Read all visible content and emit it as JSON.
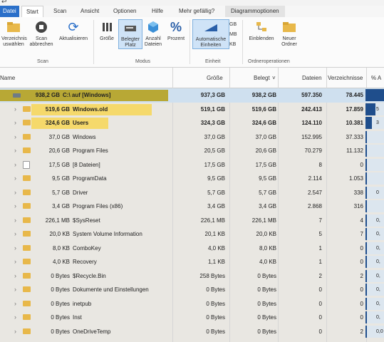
{
  "title_arrow": "↩",
  "tabs": {
    "file": "Datei",
    "start": "Start",
    "scan": "Scan",
    "view": "Ansicht",
    "options": "Optionen",
    "help": "Hilfe",
    "like": "Mehr gefällig?",
    "chart": "Diagrammoptionen"
  },
  "ribbon": {
    "select_dir": "Verzeichnis",
    "select_dir2": "uswählen",
    "scan_btn": "Scan",
    "scan_btn2": "abbrechen",
    "refresh": "Aktualisieren",
    "size": "Größe",
    "allocated": "Belegter",
    "allocated2": "Platz",
    "count": "Anzahl",
    "count2": "Dateien",
    "percent": "Prozent",
    "auto_units": "Automatische",
    "auto_units2": "Einheiten",
    "gb": "GB",
    "mb": "MB",
    "kb": "KB",
    "fold_in": "Einblenden",
    "new_folder": "Neuer",
    "new_folder2": "Ordner",
    "group_scan": "Scan",
    "group_mode": "Modus",
    "group_unit": "Einheit",
    "group_folder": "Ordneroperationen"
  },
  "columns": {
    "name": "Name",
    "size": "Größe",
    "allocated": "Belegt",
    "files": "Dateien",
    "folders": "Verzeichnisse",
    "percent": "% A"
  },
  "rows": [
    {
      "alloc_label": "938,2 GB",
      "name": "C:\\ auf [Windows]",
      "size": "937,3 GB",
      "allocated": "938,2 GB",
      "files": "597.350",
      "folders": "78.445",
      "pct": 100
    },
    {
      "alloc_label": "519,6 GB",
      "name": "Windows.old",
      "size": "519,1 GB",
      "allocated": "519,6 GB",
      "files": "242.413",
      "folders": "17.859",
      "pct": 55
    },
    {
      "alloc_label": "324,6 GB",
      "name": "Users",
      "size": "324,3 GB",
      "allocated": "324,6 GB",
      "files": "124.110",
      "folders": "10.381",
      "pct": 35
    },
    {
      "alloc_label": "37,0 GB",
      "name": "Windows",
      "size": "37,0 GB",
      "allocated": "37,0 GB",
      "files": "152.995",
      "folders": "37.333",
      "pct": 4
    },
    {
      "alloc_label": "20,6 GB",
      "name": "Program Files",
      "size": "20,5 GB",
      "allocated": "20,6 GB",
      "files": "70.279",
      "folders": "11.132",
      "pct": 2
    },
    {
      "alloc_label": "17,5 GB",
      "name": "[8 Dateien]",
      "size": "17,5 GB",
      "allocated": "17,5 GB",
      "files": "8",
      "folders": "0",
      "pct": 2
    },
    {
      "alloc_label": "9,5 GB",
      "name": "ProgramData",
      "size": "9,5 GB",
      "allocated": "9,5 GB",
      "files": "2.114",
      "folders": "1.053",
      "pct": 1
    },
    {
      "alloc_label": "5,7 GB",
      "name": "Driver",
      "size": "5,7 GB",
      "allocated": "5,7 GB",
      "files": "2.547",
      "folders": "338",
      "pct": 0.6
    },
    {
      "alloc_label": "3,4 GB",
      "name": "Program Files (x86)",
      "size": "3,4 GB",
      "allocated": "3,4 GB",
      "files": "2.868",
      "folders": "316",
      "pct": 0.4
    },
    {
      "alloc_label": "226,1 MB",
      "name": "$SysReset",
      "size": "226,1 MB",
      "allocated": "226,1 MB",
      "files": "7",
      "folders": "4",
      "pct": 0
    },
    {
      "alloc_label": "20,0 KB",
      "name": "System Volume Information",
      "size": "20,1 KB",
      "allocated": "20,0 KB",
      "files": "5",
      "folders": "7",
      "pct": 0
    },
    {
      "alloc_label": "8,0 KB",
      "name": "ComboKey",
      "size": "4,0 KB",
      "allocated": "8,0 KB",
      "files": "1",
      "folders": "0",
      "pct": 0
    },
    {
      "alloc_label": "4,0 KB",
      "name": "Recovery",
      "size": "1,1 KB",
      "allocated": "4,0 KB",
      "files": "1",
      "folders": "0",
      "pct": 0
    },
    {
      "alloc_label": "0 Bytes",
      "name": "$Recycle.Bin",
      "size": "258 Bytes",
      "allocated": "0 Bytes",
      "files": "2",
      "folders": "2",
      "pct": 0
    },
    {
      "alloc_label": "0 Bytes",
      "name": "Dokumente und Einstellungen",
      "size": "0 Bytes",
      "allocated": "0 Bytes",
      "files": "0",
      "folders": "0",
      "pct": 0
    },
    {
      "alloc_label": "0 Bytes",
      "name": "inetpub",
      "size": "0 Bytes",
      "allocated": "0 Bytes",
      "files": "0",
      "folders": "0",
      "pct": 0
    },
    {
      "alloc_label": "0 Bytes",
      "name": "Inst",
      "size": "0 Bytes",
      "allocated": "0 Bytes",
      "files": "0",
      "folders": "0",
      "pct": 0
    },
    {
      "alloc_label": "0 Bytes",
      "name": "OneDriveTemp",
      "size": "0 Bytes",
      "allocated": "0 Bytes",
      "files": "0",
      "folders": "2",
      "pct": 0
    }
  ],
  "pct_labels": [
    "",
    "5",
    "3",
    "",
    "",
    "",
    "",
    "0",
    "",
    "0,",
    "0,",
    "0,",
    "0,",
    "0,",
    "0,",
    "0,",
    "0,",
    "0,0"
  ],
  "colors": {
    "accent": "#2a6fc9",
    "root_bar": "#b8a835",
    "big_bar": "#f5d96b",
    "pct_fill": "#1f4e8c"
  }
}
